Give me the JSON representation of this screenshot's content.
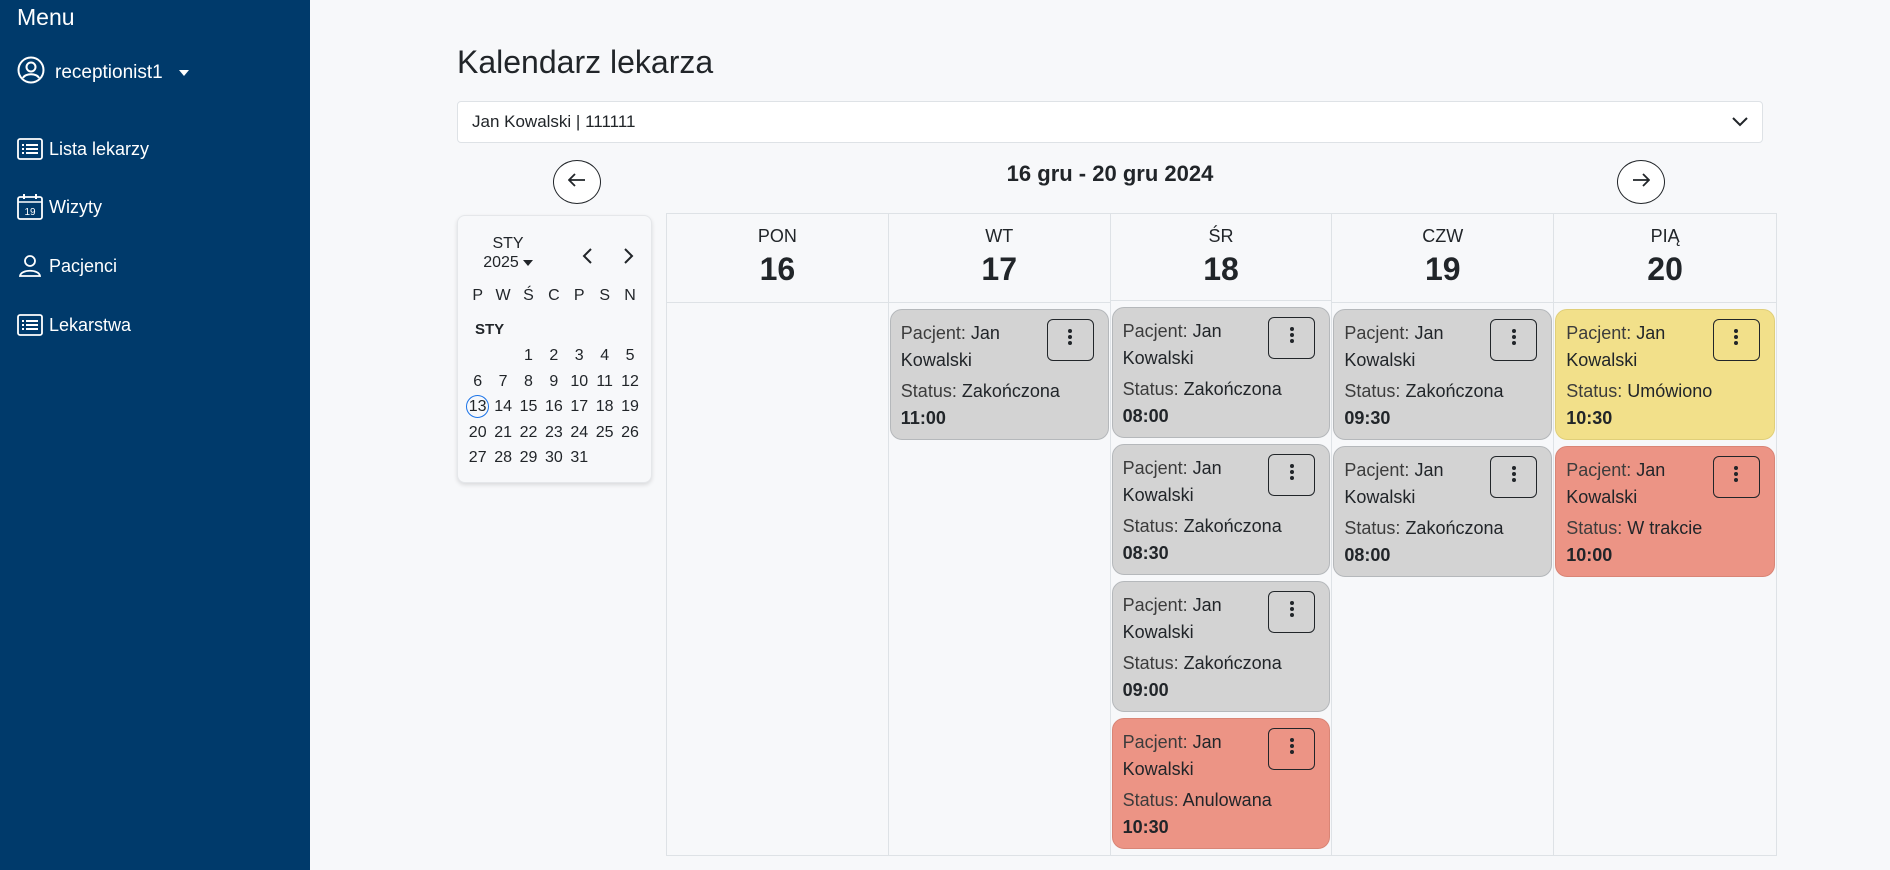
{
  "sidebar": {
    "title": "Menu",
    "user": "receptionist1",
    "items": [
      {
        "label": "Lista lekarzy",
        "icon": "list-icon"
      },
      {
        "label": "Wizyty",
        "icon": "calendar-icon",
        "icon_text": "19"
      },
      {
        "label": "Pacjenci",
        "icon": "person-icon"
      },
      {
        "label": "Lekarstwa",
        "icon": "list-icon"
      }
    ]
  },
  "main": {
    "title": "Kalendarz lekarza",
    "doctor_select": "Jan Kowalski | 111111",
    "week_range": "16 gru - 20 gru 2024"
  },
  "mini_calendar": {
    "month": "STY",
    "year": "2025",
    "weekdays": [
      "P",
      "W",
      "Ś",
      "C",
      "P",
      "S",
      "N"
    ],
    "month_label": "STY",
    "leading_blanks": 2,
    "days": [
      "1",
      "2",
      "3",
      "4",
      "5",
      "6",
      "7",
      "8",
      "9",
      "10",
      "11",
      "12",
      "13",
      "14",
      "15",
      "16",
      "17",
      "18",
      "19",
      "20",
      "21",
      "22",
      "23",
      "24",
      "25",
      "26",
      "27",
      "28",
      "29",
      "30",
      "31"
    ],
    "today": "13"
  },
  "week": {
    "patient_label": "Pacjent:",
    "status_label": "Status:",
    "days": [
      {
        "name": "PON",
        "num": "16",
        "appointments": []
      },
      {
        "name": "WT",
        "num": "17",
        "appointments": [
          {
            "patient": "Jan Kowalski",
            "status": "Zakończona",
            "time": "11:00",
            "kind": "done"
          }
        ]
      },
      {
        "name": "ŚR",
        "num": "18",
        "appointments": [
          {
            "patient": "Jan Kowalski",
            "status": "Zakończona",
            "time": "08:00",
            "kind": "done"
          },
          {
            "patient": "Jan Kowalski",
            "status": "Zakończona",
            "time": "08:30",
            "kind": "done"
          },
          {
            "patient": "Jan Kowalski",
            "status": "Zakończona",
            "time": "09:00",
            "kind": "done"
          },
          {
            "patient": "Jan Kowalski",
            "status": "Anulowana",
            "time": "10:30",
            "kind": "cancelled"
          }
        ]
      },
      {
        "name": "CZW",
        "num": "19",
        "appointments": [
          {
            "patient": "Jan Kowalski",
            "status": "Zakończona",
            "time": "09:30",
            "kind": "done"
          },
          {
            "patient": "Jan Kowalski",
            "status": "Zakończona",
            "time": "08:00",
            "kind": "done"
          }
        ]
      },
      {
        "name": "PIĄ",
        "num": "20",
        "appointments": [
          {
            "patient": "Jan Kowalski",
            "status": "Umówiono",
            "time": "10:30",
            "kind": "scheduled"
          },
          {
            "patient": "Jan Kowalski",
            "status": "W trakcie",
            "time": "10:00",
            "kind": "inprogress"
          }
        ]
      }
    ]
  },
  "colors": {
    "sidebar_bg": "#003a6b",
    "done": "#d3d3d3",
    "scheduled": "#f2e08a",
    "cancelled": "#ec9485",
    "today_ring": "#1a73e8"
  }
}
